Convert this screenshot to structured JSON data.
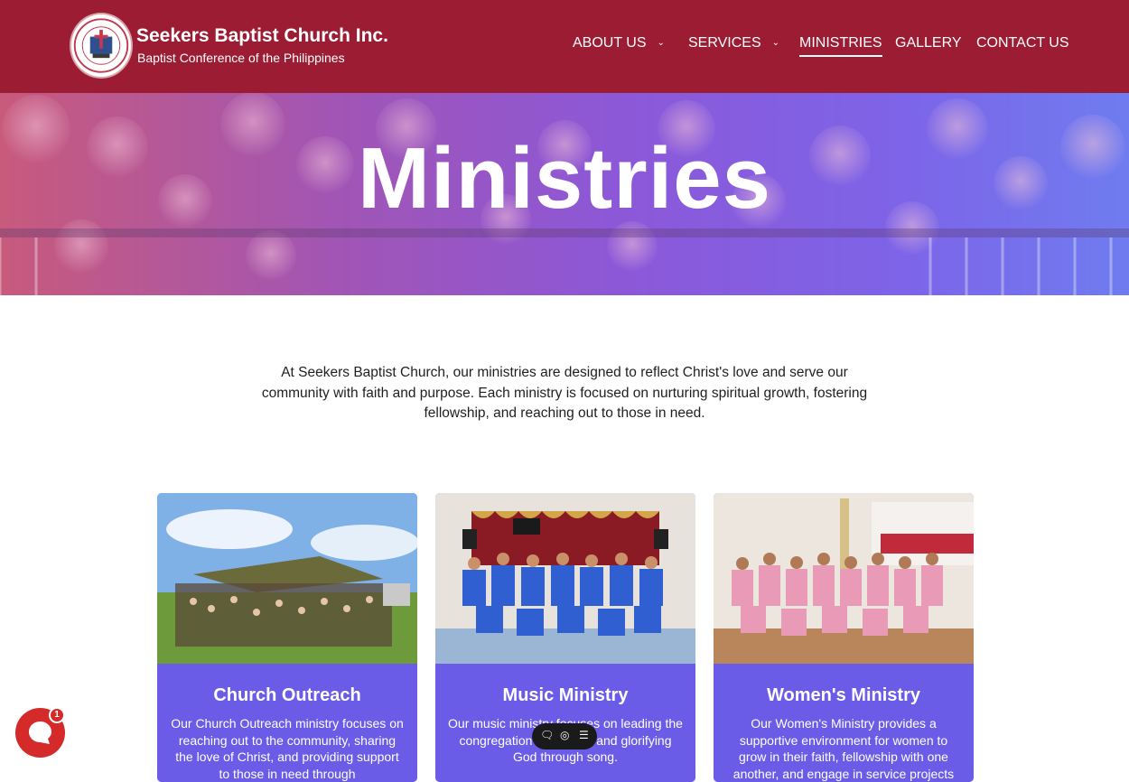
{
  "header": {
    "brand_title": "Seekers Baptist Church Inc.",
    "brand_subtitle": "Baptist Conference of the Philippines",
    "logo_icon": "church-seal-logo",
    "background": "#9c1c33"
  },
  "nav": {
    "items": [
      {
        "label": "ABOUT US",
        "has_dropdown": true
      },
      {
        "label": "SERVICES",
        "has_dropdown": true
      },
      {
        "label": "MINISTRIES",
        "active": true
      },
      {
        "label": "GALLERY"
      },
      {
        "label": "CONTACT US"
      }
    ]
  },
  "hero": {
    "title": "Ministries",
    "overlay_colors": [
      "#c85a7c",
      "#8c58d8",
      "#6f7cf0"
    ]
  },
  "intro": {
    "text": "At Seekers Baptist Church, our ministries are designed to reflect Christ's love and serve our community with faith and purpose. Each ministry is focused on nurturing spiritual growth, fostering fellowship, and reaching out to those in need."
  },
  "cards": [
    {
      "title": "Church Outreach",
      "description": "Our Church Outreach ministry focuses on reaching out to the community, sharing the love of Christ, and providing support to those in need through"
    },
    {
      "title": "Music Ministry",
      "description": "Our music ministry focuses on leading the congregation in worship and glorifying God through song."
    },
    {
      "title": "Women's Ministry",
      "description": "Our Women's Ministry provides a supportive environment for women to grow in their faith, fellowship with one another, and engage in service projects"
    }
  ],
  "chat_widget": {
    "icon": "chat-icon",
    "badge_count": "1",
    "color": "#d42a2a"
  },
  "floating_toolbar": {
    "icons": [
      "comment-icon",
      "eye-icon",
      "list-icon"
    ]
  },
  "colors": {
    "card_body": "#6a5ce6",
    "accent_red": "#9c1c33"
  }
}
